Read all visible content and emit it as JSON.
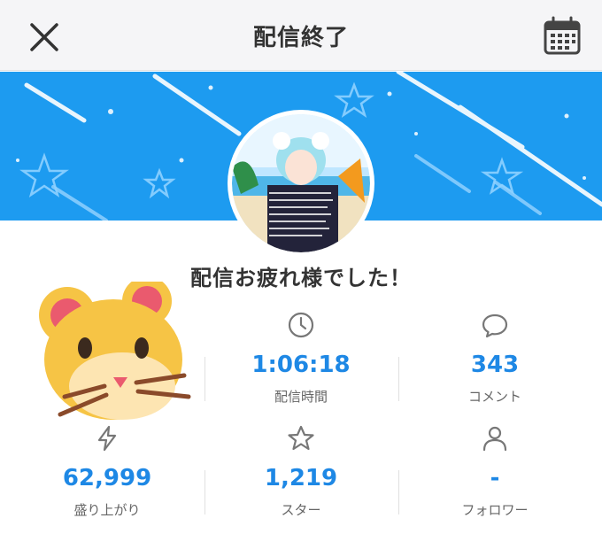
{
  "header": {
    "title": "配信終了",
    "close_icon": "close-icon",
    "calendar_icon": "calendar-icon"
  },
  "banner": {
    "color": "#1d9bf0"
  },
  "message": "配信お疲れ様でした！",
  "stats": [
    {
      "key": "time",
      "icon": "clock-icon",
      "value": "1:06:18",
      "label": "配信時間"
    },
    {
      "key": "comments",
      "icon": "comment-icon",
      "value": "343",
      "label": "コメント"
    },
    {
      "key": "excitement",
      "icon": "lightning-icon",
      "value": "62,999",
      "label": "盛り上がり"
    },
    {
      "key": "stars",
      "icon": "star-icon",
      "value": "1,219",
      "label": "スター"
    },
    {
      "key": "followers",
      "icon": "person-icon",
      "value": "-",
      "label": "フォロワー"
    }
  ],
  "colors": {
    "accent": "#1e88e5",
    "icon_gray": "#777777"
  }
}
